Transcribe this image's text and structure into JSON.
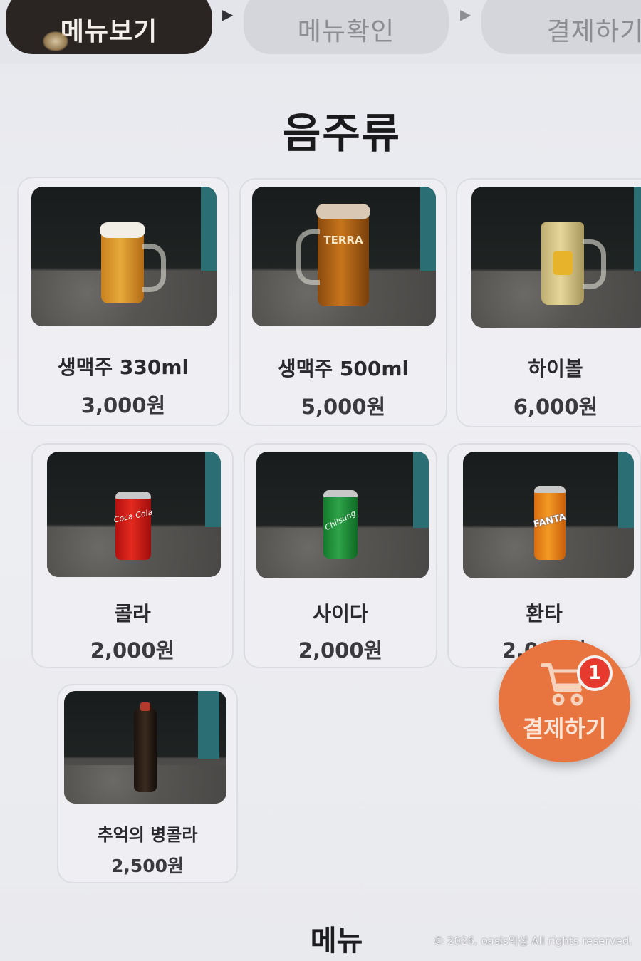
{
  "steps": {
    "step1": "메뉴보기",
    "step2": "메뉴확인",
    "step3": "결제하기",
    "arrow": "▶"
  },
  "category": "음주류",
  "items": [
    {
      "name": "생맥주 330ml",
      "price": "3,000원"
    },
    {
      "name": "생맥주 500ml",
      "price": "5,000원"
    },
    {
      "name": "하이볼",
      "price": "6,000원"
    },
    {
      "name": "콜라",
      "price": "2,000원"
    },
    {
      "name": "사이다",
      "price": "2,000원"
    },
    {
      "name": "환타",
      "price": "2,000원"
    },
    {
      "name": "추억의 병콜라",
      "price": "2,500원"
    }
  ],
  "product_labels": {
    "terra": "TERRA",
    "coke": "Coca-Cola",
    "chilsung": "Chilsung",
    "fanta": "FANTA"
  },
  "pay_button": {
    "label": "결제하기",
    "cart_count": "1",
    "accent": "#e8743f",
    "badge_color": "#e63a2f"
  },
  "footer": {
    "title": "메뉴"
  },
  "copyright": "© 2026. oasis익성 All rights reserved."
}
